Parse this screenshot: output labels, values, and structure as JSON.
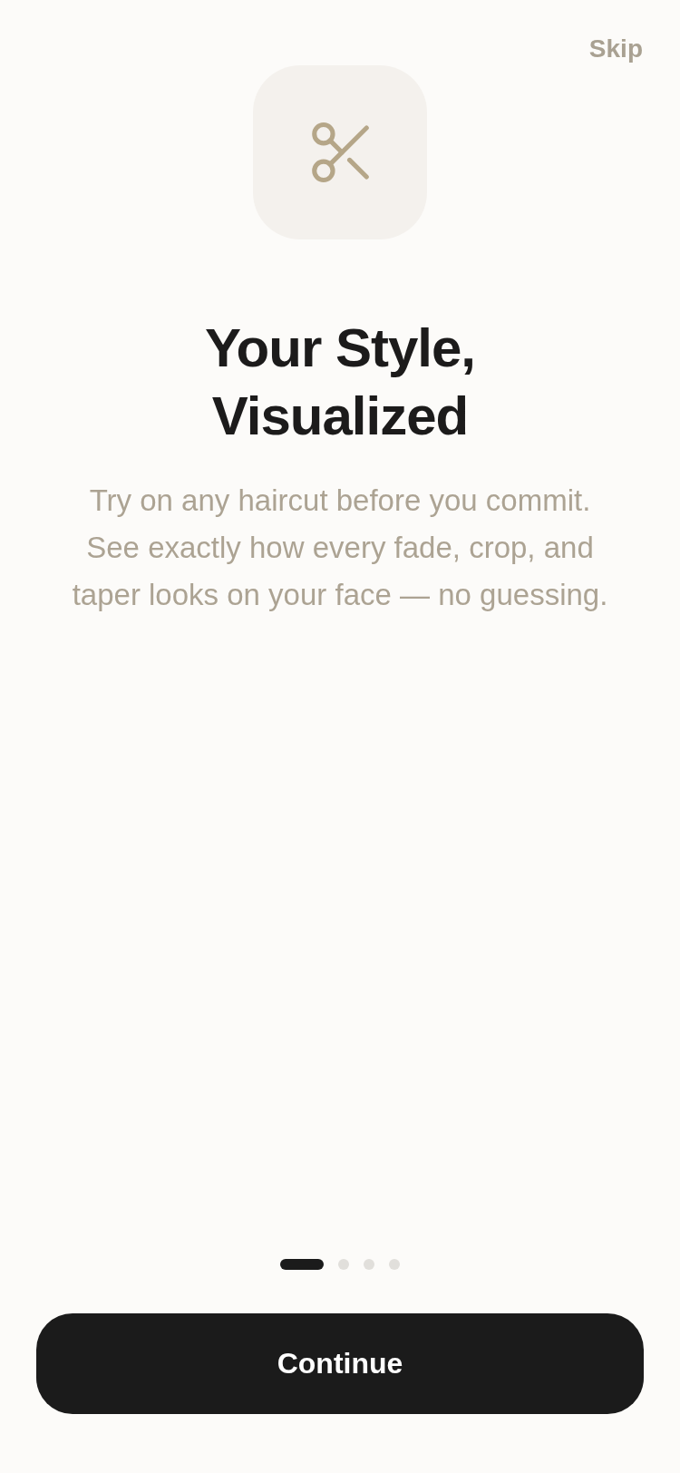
{
  "header": {
    "skip_label": "Skip"
  },
  "hero": {
    "title": "Your Style, Visualized",
    "description": "Try on any haircut before you commit. See exactly how every fade, crop, and taper looks on your face — no guessing."
  },
  "pager": [
    {
      "selected": true
    },
    {
      "selected": false
    },
    {
      "selected": false
    },
    {
      "selected": false
    }
  ],
  "primary_button": {
    "label": "Continue"
  }
}
